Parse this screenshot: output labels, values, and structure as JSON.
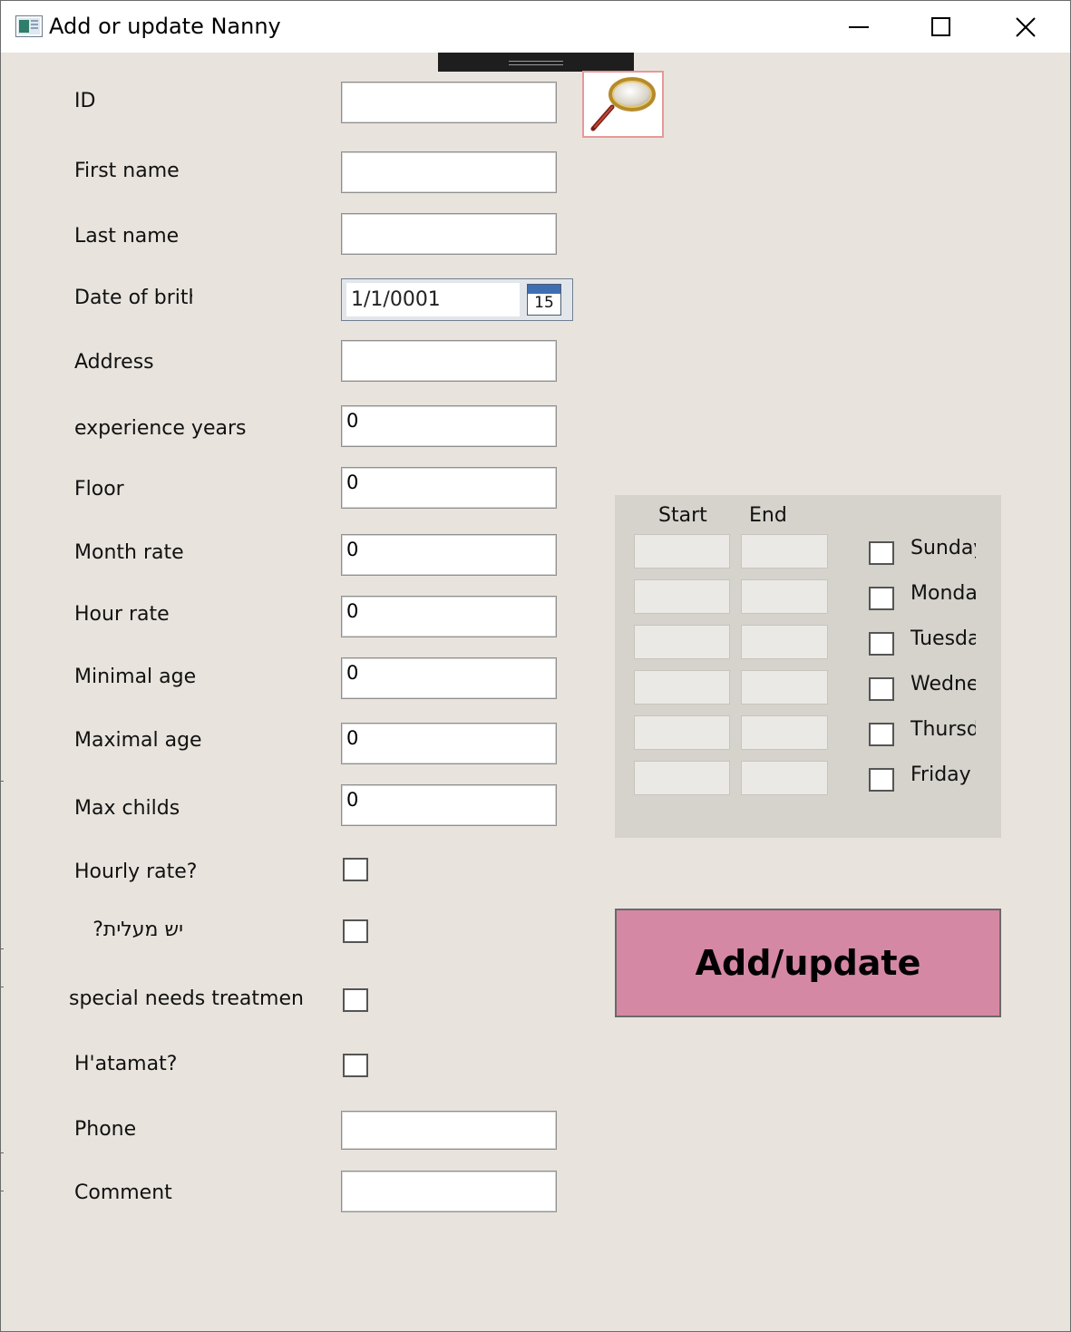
{
  "window": {
    "title": "Add or update Nanny"
  },
  "form": {
    "id_label": "ID",
    "first_name_label": "First name",
    "last_name_label": "Last name",
    "dob_label": "Date of brith",
    "dob_value": "1/1/0001",
    "calendar_day": "15",
    "address_label": "Address",
    "experience_label": "experience years",
    "experience_value": "0",
    "floor_label": "Floor",
    "floor_value": "0",
    "month_rate_label": "Month rate",
    "month_rate_value": "0",
    "hour_rate_label": "Hour rate",
    "hour_rate_value": "0",
    "min_age_label": "Minimal age",
    "min_age_value": "0",
    "max_age_label": "Maximal age",
    "max_age_value": "0",
    "max_childs_label": "Max childs",
    "max_childs_value": "0",
    "hourly_rate_q": "Hourly rate?",
    "elevator_q": "יש מעלית?",
    "special_needs_q": "special needs treatment?",
    "hatamat_q": "H'atamat?",
    "phone_label": "Phone",
    "comment_label": "Comment"
  },
  "schedule": {
    "start_header": "Start",
    "end_header": "End",
    "days": [
      "Sunday",
      "Monday",
      "Tuesday",
      "Wednesday",
      "Thursday",
      "Friday"
    ]
  },
  "actions": {
    "add_update_label": "Add/update"
  },
  "icons": {
    "app": "app-window-icon",
    "search": "magnifier-icon",
    "calendar": "calendar-icon"
  }
}
